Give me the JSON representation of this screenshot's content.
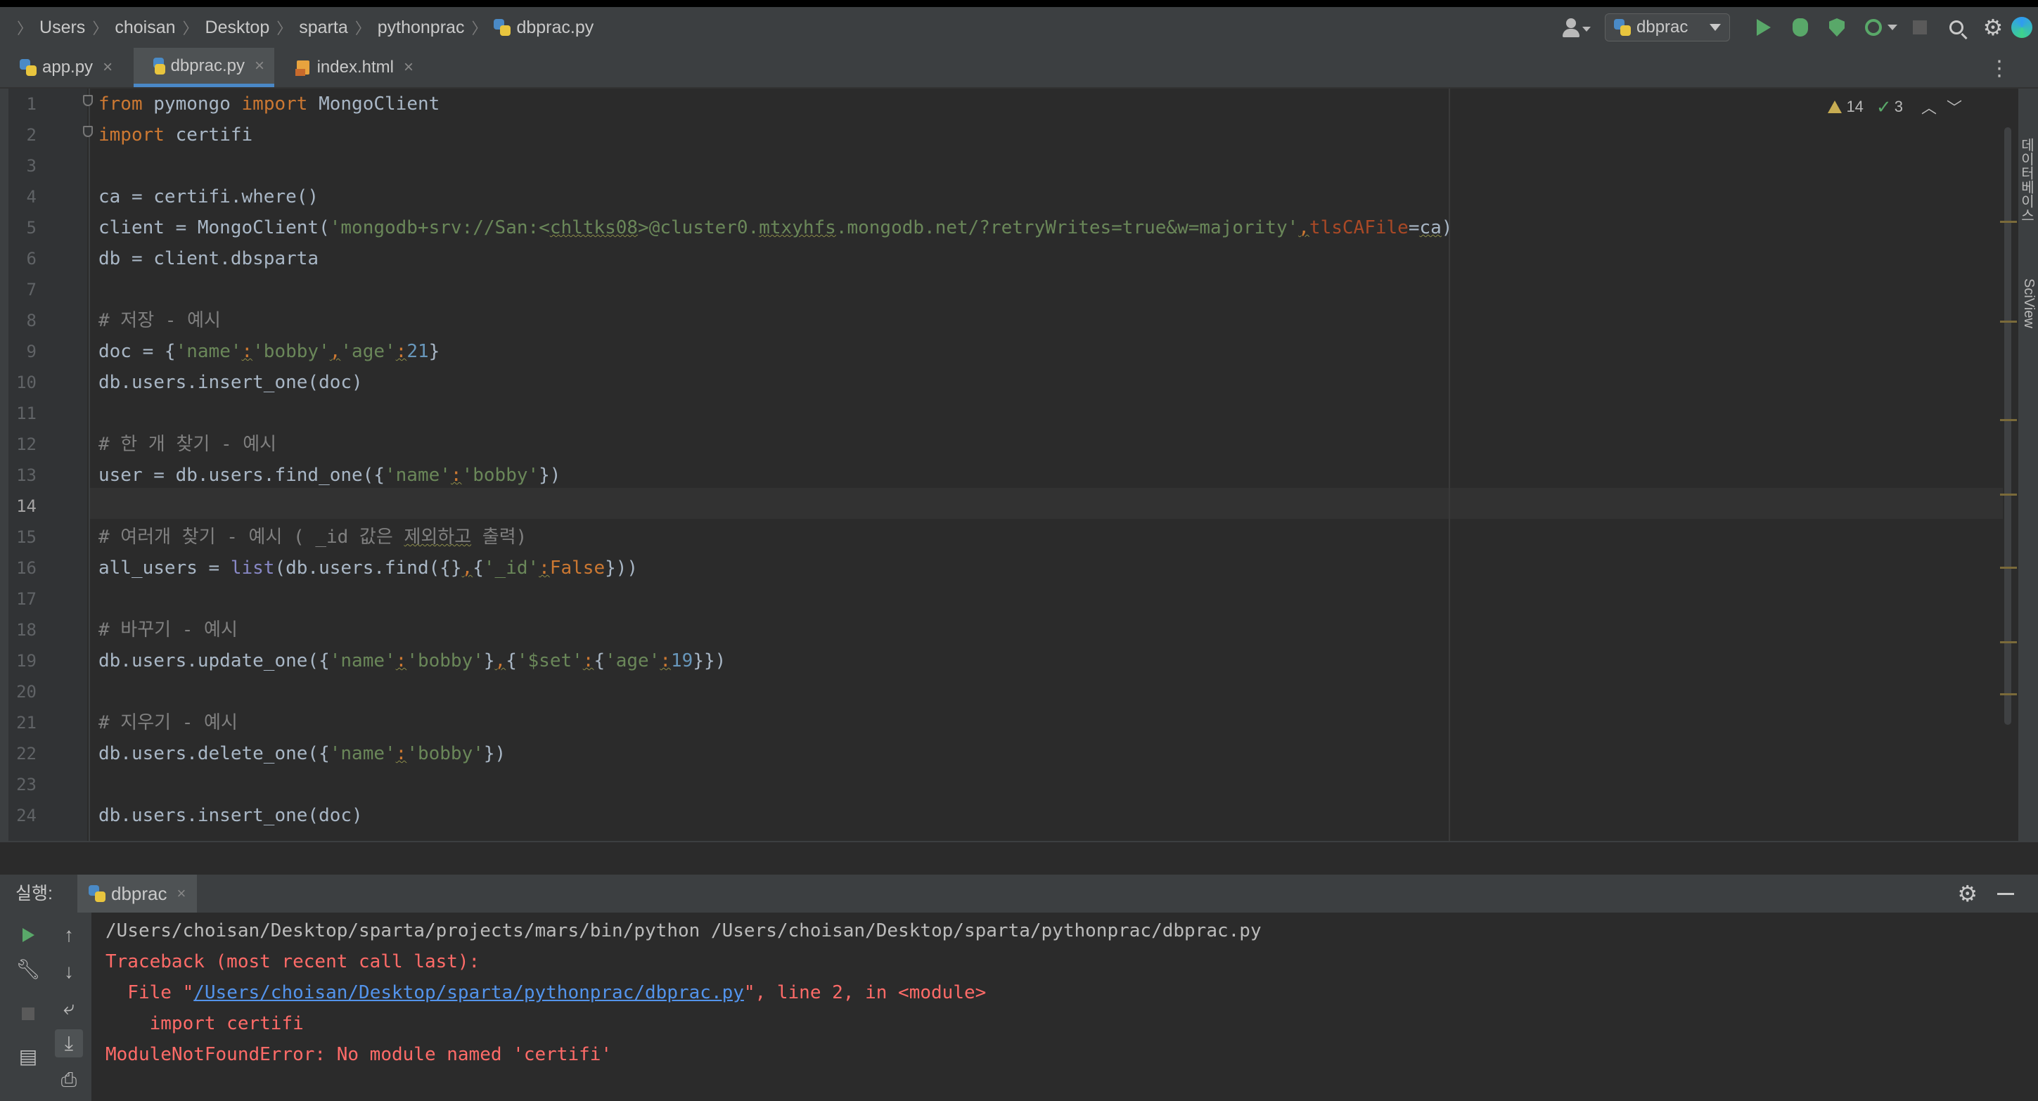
{
  "breadcrumbs": [
    "Users",
    "choisan",
    "Desktop",
    "sparta",
    "pythonprac",
    "dbprac.py"
  ],
  "run_config": {
    "name": "dbprac"
  },
  "tabs": [
    {
      "label": "app.py",
      "active": false,
      "icon": "python-file-icon"
    },
    {
      "label": "dbprac.py",
      "active": true,
      "icon": "python-file-icon"
    },
    {
      "label": "index.html",
      "active": false,
      "icon": "html-file-icon"
    }
  ],
  "inspections": {
    "warnings": "14",
    "weak_warnings": "3"
  },
  "side_panels": [
    "데이터베이스",
    "SciView"
  ],
  "editor": {
    "line_numbers": [
      "1",
      "2",
      "3",
      "4",
      "5",
      "6",
      "7",
      "8",
      "9",
      "10",
      "11",
      "12",
      "13",
      "14",
      "15",
      "16",
      "17",
      "18",
      "19",
      "20",
      "21",
      "22",
      "23",
      "24"
    ],
    "current_line": "14",
    "lines": {
      "l1": {
        "kw1": "from",
        "t1": " pymongo ",
        "kw2": "import",
        "t2": " MongoClient"
      },
      "l2": {
        "kw1": "import",
        "t1": " certifi"
      },
      "l4": {
        "t1": "ca = certifi.where()"
      },
      "l5": {
        "t1": "client = MongoClient(",
        "s1": "'mongodb+srv://San:<",
        "s2": "chltks08",
        "s3": ">@cluster0.",
        "s4": "mtxyhfs",
        "s5": ".mongodb.net/?retryWrites=true&w=majority'",
        "c1": ",",
        "p1": "tlsCAFile",
        "t2": "=",
        "t3": "ca",
        "t4": ")"
      },
      "l6": {
        "t1": "db = client.dbsparta"
      },
      "l8": {
        "c1": "# 저장 - 예시"
      },
      "l9": {
        "t1": "doc = {",
        "s1": "'name'",
        "k1": ":",
        "s2": "'bobby'",
        "k2": ",",
        "s3": "'age'",
        "k3": ":",
        "n1": "21",
        "t2": "}"
      },
      "l10": {
        "t1": "db.users.insert_one(doc)"
      },
      "l12": {
        "c1": "# 한 개 찾기 - 예시"
      },
      "l13": {
        "t1": "user = db.users.find_one({",
        "s1": "'name'",
        "k1": ":",
        "s2": "'bobby'",
        "t2": "})"
      },
      "l15": {
        "c1": "# 여러개 찾기 - 예시 ( _id 값은 ",
        "c2": "제외하고",
        "c3": " 출력)"
      },
      "l16": {
        "t1": "all_users = ",
        "b1": "list",
        "t2": "(db.users.find({}",
        "k1": ",",
        "t3": "{",
        "s1": "'_id'",
        "k2": ":",
        "kw1": "False",
        "t4": "}))"
      },
      "l18": {
        "c1": "# 바꾸기 - 예시"
      },
      "l19": {
        "t1": "db.users.update_one({",
        "s1": "'name'",
        "k1": ":",
        "s2": "'bobby'",
        "t2": "}",
        "k2": ",",
        "t3": "{",
        "s3": "'$set'",
        "k3": ":",
        "t4": "{",
        "s4": "'age'",
        "k4": ":",
        "n1": "19",
        "t5": "}})"
      },
      "l21": {
        "c1": "# 지우기 - 예시"
      },
      "l22": {
        "t1": "db.users.delete_one({",
        "s1": "'name'",
        "k1": ":",
        "s2": "'bobby'",
        "t2": "})"
      },
      "l24": {
        "t1": "db.users.insert_one(doc)"
      }
    }
  },
  "run_panel": {
    "label": "실행:",
    "tab": "dbprac",
    "output": {
      "cmd": "/Users/choisan/Desktop/sparta/projects/mars/bin/python /Users/choisan/Desktop/sparta/pythonprac/dbprac.py",
      "traceback": "Traceback (most recent call last):",
      "file_prefix": "  File \"",
      "file_link": "/Users/choisan/Desktop/sparta/pythonprac/dbprac.py",
      "file_suffix": "\", line 2, in <module>",
      "src": "    import certifi",
      "error": "ModuleNotFoundError: No module named 'certifi'"
    }
  }
}
